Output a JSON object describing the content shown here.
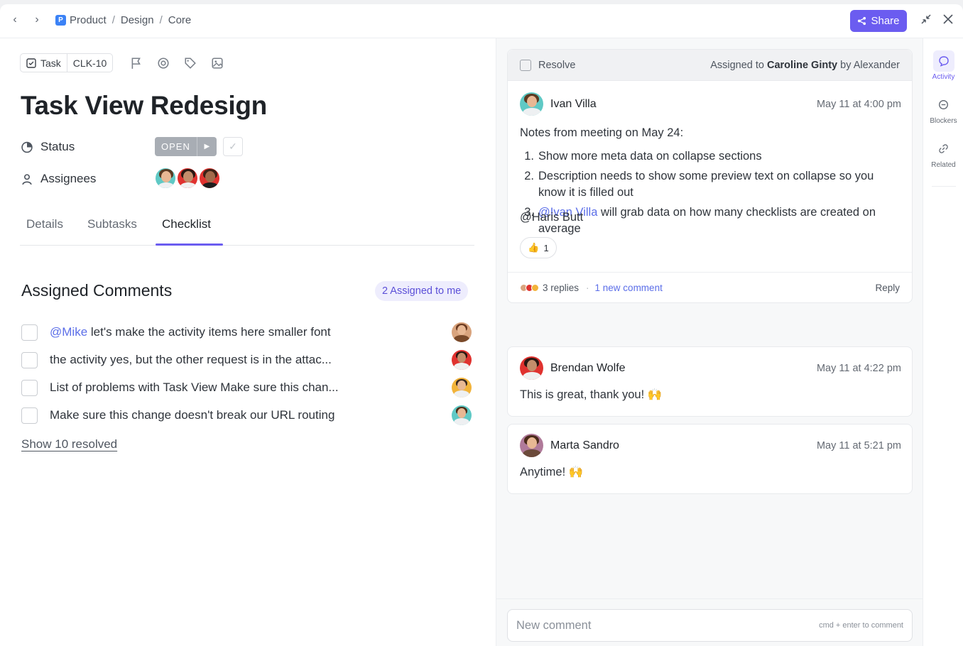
{
  "topbar": {
    "back_icon": "chevron-left-icon",
    "forward_icon": "chevron-right-icon",
    "breadcrumb": [
      "Product",
      "Design",
      "Core"
    ],
    "breadcrumb_sep": "/",
    "share_label": "Share",
    "accent": "#6b5cf0"
  },
  "task": {
    "type_label": "Task",
    "id": "CLK-10",
    "title": "Task View Redesign",
    "status_label": "Status",
    "status_value": "OPEN",
    "assignees_label": "Assignees"
  },
  "tabs": [
    "Details",
    "Subtasks",
    "Checklist"
  ],
  "active_tab": "Checklist",
  "assigned_comments": {
    "title": "Assigned Comments",
    "badge": "2 Assigned to me",
    "items": [
      {
        "mention": "@Mike",
        "text": " let's make the activity items here smaller font"
      },
      {
        "mention": "",
        "text": "the activity yes, but the other request is in the attac..."
      },
      {
        "mention": "",
        "text": "List of problems with Task View Make sure this chan..."
      },
      {
        "mention": "",
        "text": "Make sure this change doesn't break our URL routing"
      }
    ],
    "show_resolved": "Show 10 resolved"
  },
  "activity": {
    "resolve_label": "Resolve",
    "assigned_prefix": "Assigned to",
    "assigned_to": "Caroline Ginty",
    "assigned_by_prefix": "by",
    "assigned_by": "Alexander",
    "thread": {
      "author": "Ivan Villa",
      "time": "May 11 at 4:00 pm",
      "intro": "Notes from meeting on May 24:",
      "list": [
        {
          "num": "1.",
          "mention": "",
          "text": "Show more meta data on collapse sections"
        },
        {
          "num": "2.",
          "mention": "",
          "text": "Description needs to show some preview text on collapse so you know it is filled out"
        },
        {
          "num": "3.",
          "mention": "@Ivan Villa",
          "text": " will grab data on how many checklists are created on average"
        }
      ],
      "tag": "@Haris Butt",
      "reaction_count": "1",
      "replies": "3 replies",
      "new_comment": "1 new comment",
      "reply_label": "Reply"
    },
    "replies": [
      {
        "author": "Brendan Wolfe",
        "time": "May 11 at 4:22 pm",
        "text": "This is great, thank you! 🙌"
      },
      {
        "author": "Marta Sandro",
        "time": "May 11 at 5:21 pm",
        "text": "Anytime! 🙌"
      }
    ],
    "input_placeholder": "New comment",
    "input_hint": "cmd + enter to comment"
  },
  "rail": [
    {
      "label": "Activity",
      "icon": "chat-bubble-icon"
    },
    {
      "label": "Blockers",
      "icon": "minus-circle-icon"
    },
    {
      "label": "Related",
      "icon": "link-icon"
    }
  ]
}
